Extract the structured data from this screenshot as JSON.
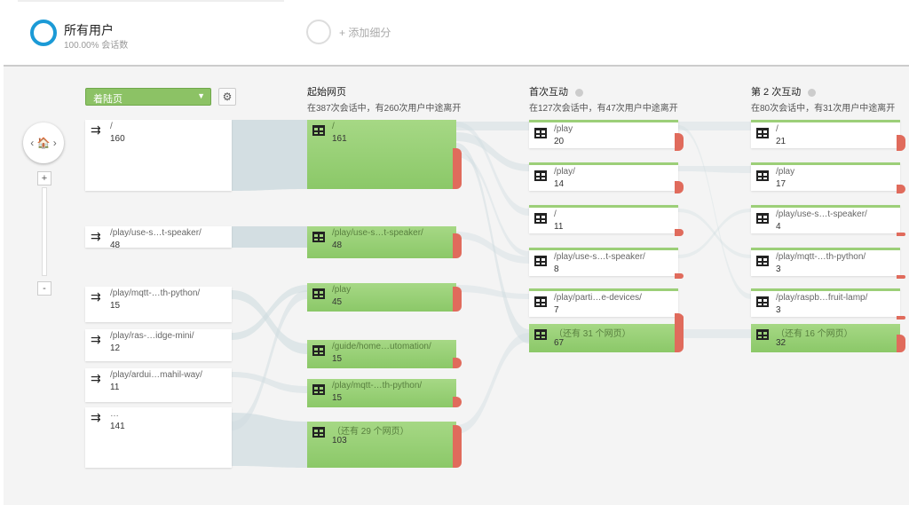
{
  "segment": {
    "name": "所有用户",
    "sub": "100.00% 会话数",
    "add_label": "+ 添加细分",
    "ring_color": "#1b9ad6"
  },
  "controls": {
    "dimension": "着陆页",
    "dropdown_icon": "chevron-down-icon",
    "settings_icon": "gear-icon",
    "home_nav": "‹ 🏠 ›",
    "zoom_in": "+",
    "zoom_out": "-"
  },
  "columns": [
    {
      "title": "起始网页",
      "sub": "在387次会话中，有260次用户中途离开"
    },
    {
      "title": "首次互动",
      "sub": "在127次会话中，有47次用户中途离开"
    },
    {
      "title": "第 2 次互动",
      "sub": "在80次会话中，有31次用户中途离开"
    }
  ],
  "sources": [
    {
      "label": "/",
      "count": "160"
    },
    {
      "label": "/play/use-s…t-speaker/",
      "count": "48"
    },
    {
      "label": "/play/mqtt-…th-python/",
      "count": "15"
    },
    {
      "label": "/play/ras-…idge-mini/",
      "count": "12"
    },
    {
      "label": "/play/ardui…mahil-way/",
      "count": "11"
    },
    {
      "label": "…",
      "count": "141"
    }
  ],
  "start_pages": [
    {
      "label": "/",
      "count": "161"
    },
    {
      "label": "/play/use-s…t-speaker/",
      "count": "48"
    },
    {
      "label": "/play",
      "count": "45"
    },
    {
      "label": "/guide/home…utomation/",
      "count": "15"
    },
    {
      "label": "/play/mqtt-…th-python/",
      "count": "15"
    },
    {
      "label": "（还有 29 个网页）",
      "count": "103"
    }
  ],
  "first_interaction": [
    {
      "label": "/play",
      "count": "20"
    },
    {
      "label": "/play/",
      "count": "14"
    },
    {
      "label": "/",
      "count": "11"
    },
    {
      "label": "/play/use-s…t-speaker/",
      "count": "8"
    },
    {
      "label": "/play/parti…e-devices/",
      "count": "7"
    },
    {
      "label": "（还有 31 个网页）",
      "count": "67"
    }
  ],
  "second_interaction": [
    {
      "label": "/",
      "count": "21"
    },
    {
      "label": "/play",
      "count": "17"
    },
    {
      "label": "/play/use-s…t-speaker/",
      "count": "4"
    },
    {
      "label": "/play/mqtt-…th-python/",
      "count": "3"
    },
    {
      "label": "/play/raspb…fruit-lamp/",
      "count": "3"
    },
    {
      "label": "（还有 16 个网页）",
      "count": "32"
    }
  ],
  "colors": {
    "node_green": "#8bc868",
    "drop_red": "#e06b5c",
    "flow": "#cfdce0",
    "canvas": "#f4f4f4"
  }
}
